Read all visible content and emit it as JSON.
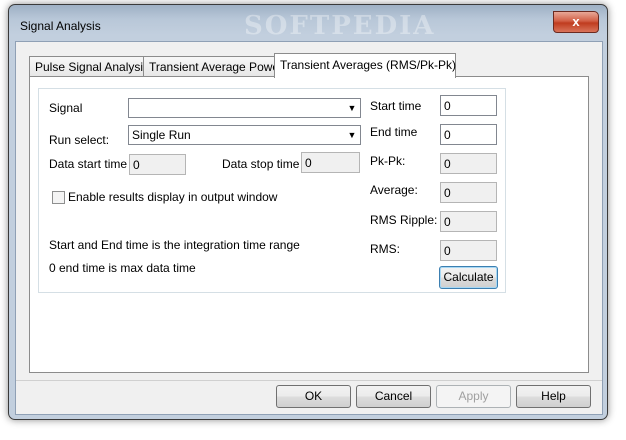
{
  "window": {
    "title": "Signal Analysis",
    "close_glyph": "x",
    "watermark": "SOFTPEDIA"
  },
  "tabs": [
    {
      "label": "Pulse Signal Analysis",
      "active": false
    },
    {
      "label": "Transient Average Power",
      "active": false
    },
    {
      "label": "Transient Averages (RMS/Pk-Pk)",
      "active": true
    }
  ],
  "form": {
    "signal_label": "Signal",
    "signal_value": "",
    "run_select_label": "Run select:",
    "run_select_value": "Single Run",
    "data_start_label": "Data start time",
    "data_start_value": "0",
    "data_stop_label": "Data stop time",
    "data_stop_value": "0",
    "enable_results_label": "Enable results display in output window",
    "enable_results_checked": false,
    "note1": "Start and End time is the integration time range",
    "note2": "0 end time is max data time"
  },
  "results": {
    "start_time_label": "Start time",
    "start_time_value": "0",
    "end_time_label": "End time",
    "end_time_value": "0",
    "pkpk_label": "Pk-Pk:",
    "pkpk_value": "0",
    "average_label": "Average:",
    "average_value": "0",
    "rms_ripple_label": "RMS Ripple:",
    "rms_ripple_value": "0",
    "rms_label": "RMS:",
    "rms_value": "0",
    "calculate_label": "Calculate"
  },
  "buttons": {
    "ok": "OK",
    "cancel": "Cancel",
    "apply": "Apply",
    "help": "Help"
  },
  "icons": {
    "dropdown": "chevron-down-icon",
    "close": "close-icon"
  }
}
